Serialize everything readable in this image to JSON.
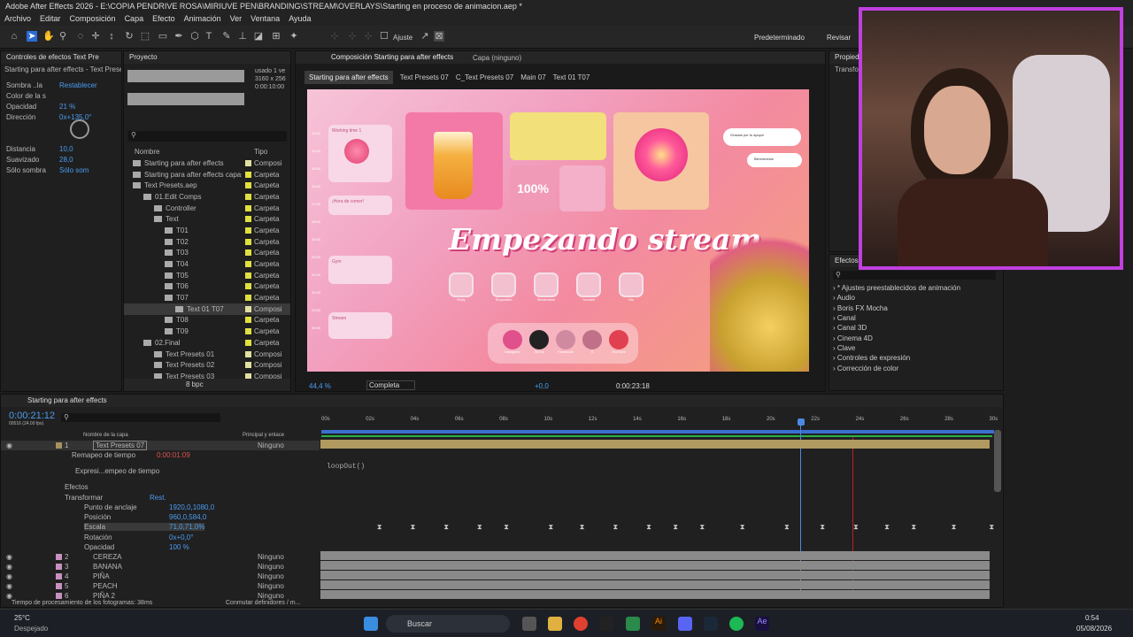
{
  "window": {
    "title": "Adobe After Effects 2026 - E:\\COPIA PENDRIVE ROSA\\MIRIUVE PEN\\BRANDING\\STREAM\\OVERLAYS\\Starting en proceso de animacion.aep *"
  },
  "menu": [
    "Archivo",
    "Editar",
    "Composición",
    "Capa",
    "Efecto",
    "Animación",
    "Ver",
    "Ventana",
    "Ayuda"
  ],
  "toolbar": {
    "adjust_label": "Ajuste",
    "workspace": "Predeterminado",
    "review": "Revisar"
  },
  "effects_controls": {
    "tab": "Controles de efectos Text Pre",
    "layer": "Starting para after effects - Text Presets 0",
    "items": [
      {
        "label": "Sombra ..la",
        "value": "Restablecer"
      },
      {
        "label": "Color de la s",
        "value": ""
      },
      {
        "label": "Opacidad",
        "value": "21 %"
      },
      {
        "label": "Dirección",
        "value": "0x+135,0°"
      },
      {
        "label": "Distancia",
        "value": "10,0"
      },
      {
        "label": "Suavizado",
        "value": "28,0"
      },
      {
        "label": "Sólo sombra",
        "value": "Sólo som"
      }
    ]
  },
  "project": {
    "tab": "Proyecto",
    "info": [
      "usado 1 ve",
      "3160 x 256",
      "0:00:10:00"
    ],
    "search_placeholder": "",
    "col_name": "Nombre",
    "col_type": "Tipo",
    "items": [
      {
        "name": "Starting para after effects",
        "type": "Composi",
        "indent": 0,
        "color": "#e0e0a0"
      },
      {
        "name": "Starting para after effects capas",
        "type": "Carpeta",
        "indent": 0,
        "color": "#e0e040"
      },
      {
        "name": "Text Presets.aep",
        "type": "Carpeta",
        "indent": 0,
        "color": "#e0e040"
      },
      {
        "name": "01.Edit Comps",
        "type": "Carpeta",
        "indent": 1,
        "color": "#e0e040"
      },
      {
        "name": "Controller",
        "type": "Carpeta",
        "indent": 2,
        "color": "#e0e040"
      },
      {
        "name": "Text",
        "type": "Carpeta",
        "indent": 2,
        "color": "#e0e040"
      },
      {
        "name": "T01",
        "type": "Carpeta",
        "indent": 3,
        "color": "#e0e040"
      },
      {
        "name": "T02",
        "type": "Carpeta",
        "indent": 3,
        "color": "#e0e040"
      },
      {
        "name": "T03",
        "type": "Carpeta",
        "indent": 3,
        "color": "#e0e040"
      },
      {
        "name": "T04",
        "type": "Carpeta",
        "indent": 3,
        "color": "#e0e040"
      },
      {
        "name": "T05",
        "type": "Carpeta",
        "indent": 3,
        "color": "#e0e040"
      },
      {
        "name": "T06",
        "type": "Carpeta",
        "indent": 3,
        "color": "#e0e040"
      },
      {
        "name": "T07",
        "type": "Carpeta",
        "indent": 3,
        "color": "#e0e040"
      },
      {
        "name": "Text 01 T07",
        "type": "Composi",
        "indent": 4,
        "color": "#e0e0a0"
      },
      {
        "name": "T08",
        "type": "Carpeta",
        "indent": 3,
        "color": "#e0e040"
      },
      {
        "name": "T09",
        "type": "Carpeta",
        "indent": 3,
        "color": "#e0e040"
      },
      {
        "name": "02.Final",
        "type": "Carpeta",
        "indent": 1,
        "color": "#e0e040"
      },
      {
        "name": "Text Presets 01",
        "type": "Composi",
        "indent": 2,
        "color": "#e0e0a0"
      },
      {
        "name": "Text Presets 02",
        "type": "Composi",
        "indent": 2,
        "color": "#e0e0a0"
      },
      {
        "name": "Text Presets 03",
        "type": "Composi",
        "indent": 2,
        "color": "#e0e0a0"
      }
    ],
    "bit_depth": "8 bpc"
  },
  "composition": {
    "tab": "Composición Starting para after effects",
    "layer_tab": "Capa (ninguno)",
    "breadcrumbs": [
      "Starting para after effects",
      "Text Presets 07",
      "C_Text Presets 07",
      "Main 07",
      "Text 01 T07"
    ],
    "zoom": "44,4 %",
    "resolution": "Completa",
    "exposure": "+0,0",
    "timecode": "0:00:23:18",
    "overlay": {
      "title": "Empezando stream...",
      "percent": "100%",
      "cards": [
        "Working time 1",
        "¡Hora de comer!",
        "Gym",
        "Stream"
      ],
      "bubbles": [
        "Gracias por tu apoyo!",
        "Bienvenidos"
      ],
      "hour_ticks": [
        "13:00",
        "14:00",
        "15:00",
        "16:00",
        "17:00",
        "18:00",
        "19:00",
        "20:00",
        "21:00",
        "22:00",
        "23:00",
        "00:00"
      ],
      "app_labels": [
        "Ruby",
        "Stopwatch",
        "Streamtime",
        "Youtube",
        "Oto"
      ],
      "social_labels": [
        "Instagram",
        "TikTok",
        "Facebook",
        "X",
        "YouTube"
      ]
    }
  },
  "right_panel": {
    "properties_tab": "Propieda",
    "transform_label": "Transfor",
    "effects_tab": "Efectos y",
    "effects": [
      "* Ajustes preestablecidos de animación",
      "Audio",
      "Boris FX Mocha",
      "Canal",
      "Canal 3D",
      "Cinema 4D",
      "Clave",
      "Controles de expresión",
      "Corrección de color"
    ]
  },
  "timeline": {
    "tab": "Starting para after effects",
    "timecode": "0:00:21:12",
    "fps": "00516 (24.00 fps)",
    "col_layer": "Nombre de la capa",
    "col_parent": "Principal y enlace",
    "ruler": [
      "00s",
      "02s",
      "04s",
      "06s",
      "08s",
      "10s",
      "12s",
      "14s",
      "16s",
      "18s",
      "20s",
      "22s",
      "24s",
      "26s",
      "28s",
      "30s"
    ],
    "layers": [
      {
        "num": "1",
        "name": "Text Presets 07",
        "parent": "Ninguno",
        "color": "#a89060"
      },
      {
        "num": "2",
        "name": "CEREZA",
        "parent": "Ninguno",
        "color": "#c890c0"
      },
      {
        "num": "3",
        "name": "BANANA",
        "parent": "Ninguno",
        "color": "#c890c0"
      },
      {
        "num": "4",
        "name": "PIÑA",
        "parent": "Ninguno",
        "color": "#c890c0"
      },
      {
        "num": "5",
        "name": "PEACH",
        "parent": "Ninguno",
        "color": "#c890c0"
      },
      {
        "num": "6",
        "name": "PIÑA 2",
        "parent": "Ninguno",
        "color": "#c890c0"
      }
    ],
    "props": [
      {
        "label": "Remapeo de tiempo",
        "value": "0:00:01:09"
      },
      {
        "label": "Expresi...empeo de tiempo",
        "value": ""
      },
      {
        "label": "Efectos",
        "value": ""
      },
      {
        "label": "Transformar",
        "value": "Rest."
      },
      {
        "label": "Punto de anclaje",
        "value": "1920,0,1080,0"
      },
      {
        "label": "Posición",
        "value": "960,0,584,0"
      },
      {
        "label": "Escala",
        "value": "71,0,71,0%"
      },
      {
        "label": "Rotación",
        "value": "0x+0,0°"
      },
      {
        "label": "Opacidad",
        "value": "100 %"
      }
    ],
    "expression": "loopOut()",
    "render_time_label": "Tiempo de procesamiento de los fotogramas:",
    "render_time": "38ms",
    "toggle": "Conmutar definidores / m..."
  },
  "taskbar": {
    "weather_temp": "25°C",
    "weather_desc": "Despejado",
    "search": "Buscar",
    "time": "0:54",
    "date": "05/08/2026"
  }
}
